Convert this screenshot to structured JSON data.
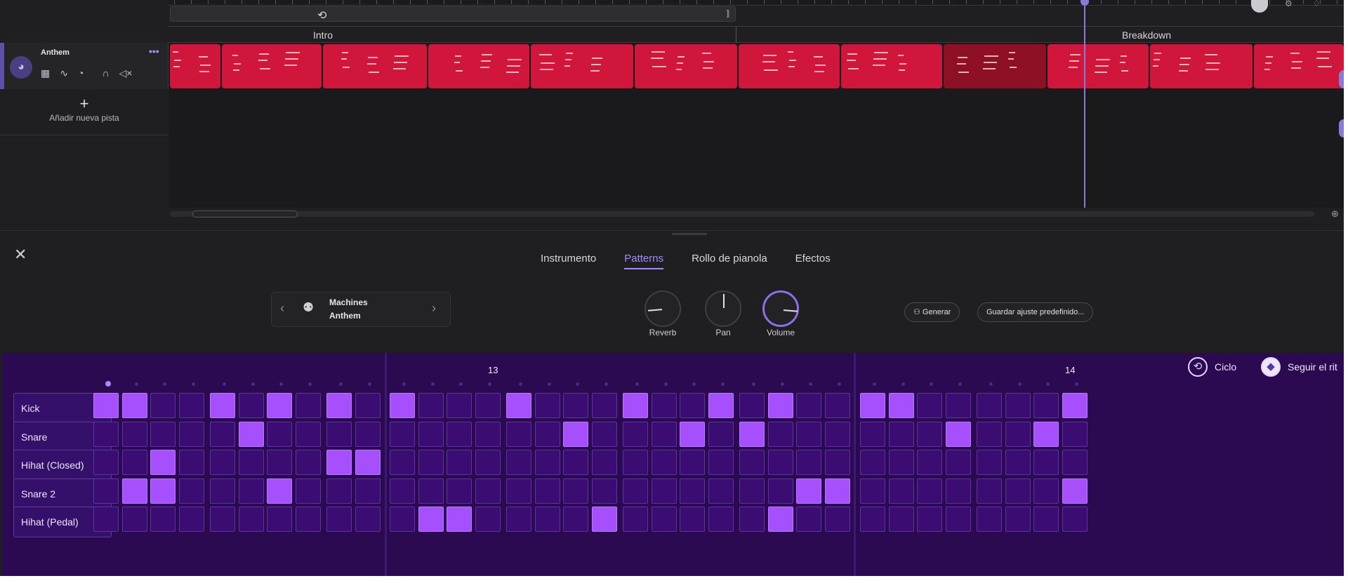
{
  "timeline": {
    "sections": [
      {
        "label": "Intro"
      },
      {
        "label": "Breakdown"
      }
    ],
    "track": {
      "name": "Anthem",
      "more_icon": "ellipsis-icon",
      "icons": [
        "pads-icon",
        "eq-icon",
        "knob-icon",
        "headphones-icon",
        "mute-icon"
      ]
    },
    "add_track_label": "Añadir nueva pista",
    "clip_color": "#d0163a",
    "selected_clip_color": "#8e1024",
    "playhead_color": "#8b7bd4"
  },
  "editor": {
    "tabs": [
      {
        "label": "Instrumento",
        "active": false
      },
      {
        "label": "Patterns",
        "active": true
      },
      {
        "label": "Rollo de pianola",
        "active": false
      },
      {
        "label": "Efectos",
        "active": false
      }
    ],
    "instrument": {
      "line1": "Machines",
      "line2": "Anthem"
    },
    "knobs": [
      {
        "label": "Reverb",
        "value": 0.15
      },
      {
        "label": "Pan",
        "value": 0.5
      },
      {
        "label": "Volume",
        "value": 0.85
      }
    ],
    "generate_label": "Generar",
    "save_preset_label": "Guardar ajuste predefinido..."
  },
  "sequencer": {
    "bar_numbers": [
      "13",
      "14"
    ],
    "loop_label": "Ciclo",
    "follow_label": "Seguir el rit",
    "accent_color": "#a64ffc",
    "rows": [
      {
        "name": "Kick",
        "steps": [
          1,
          1,
          0,
          0,
          1,
          0,
          1,
          0,
          1,
          0,
          1,
          0,
          0,
          0,
          1,
          0,
          0,
          0,
          1,
          0,
          0,
          1,
          0,
          1,
          0,
          0,
          1,
          1,
          0,
          0,
          0,
          0,
          0,
          1
        ]
      },
      {
        "name": "Snare",
        "steps": [
          0,
          0,
          0,
          0,
          0,
          1,
          0,
          0,
          0,
          0,
          0,
          0,
          0,
          0,
          0,
          0,
          1,
          0,
          0,
          0,
          1,
          0,
          1,
          0,
          0,
          0,
          0,
          0,
          0,
          1,
          0,
          0,
          1,
          0
        ]
      },
      {
        "name": "Hihat (Closed)",
        "steps": [
          0,
          0,
          1,
          0,
          0,
          0,
          0,
          0,
          1,
          1,
          0,
          0,
          0,
          0,
          0,
          0,
          0,
          0,
          0,
          0,
          0,
          0,
          0,
          0,
          0,
          0,
          0,
          0,
          0,
          0,
          0,
          0,
          0,
          0
        ]
      },
      {
        "name": "Snare 2",
        "steps": [
          0,
          1,
          1,
          0,
          0,
          0,
          1,
          0,
          0,
          0,
          0,
          0,
          0,
          0,
          0,
          0,
          0,
          0,
          0,
          0,
          0,
          0,
          0,
          0,
          1,
          1,
          0,
          0,
          0,
          0,
          0,
          0,
          0,
          1
        ]
      },
      {
        "name": "Hihat (Pedal)",
        "steps": [
          0,
          0,
          0,
          0,
          0,
          0,
          0,
          0,
          0,
          0,
          0,
          1,
          1,
          0,
          0,
          0,
          0,
          1,
          0,
          0,
          0,
          0,
          0,
          1,
          0,
          0,
          0,
          0,
          0,
          0,
          0,
          0,
          0,
          0
        ]
      }
    ]
  }
}
